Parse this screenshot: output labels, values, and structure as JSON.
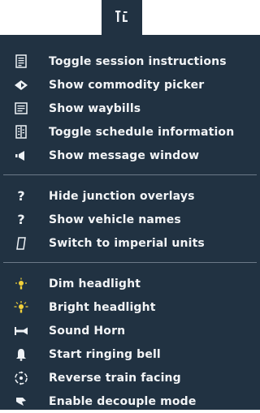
{
  "colors": {
    "panel_bg": "#213242",
    "text": "#f2f4f6",
    "headlight_yellow": "#f2d13a",
    "separator": "#6b7988"
  },
  "trigger": {
    "icon": "rail-tools-icon"
  },
  "groups": [
    [
      {
        "icon": "document-icon",
        "label": "Toggle session instructions"
      },
      {
        "icon": "commodity-picker-icon",
        "label": "Show commodity picker"
      },
      {
        "icon": "waybills-icon",
        "label": "Show waybills"
      },
      {
        "icon": "schedule-icon",
        "label": "Toggle schedule information"
      },
      {
        "icon": "message-window-icon",
        "label": "Show message window"
      }
    ],
    [
      {
        "icon": "question-icon",
        "label": "Hide junction overlays"
      },
      {
        "icon": "question-icon",
        "label": "Show vehicle names"
      },
      {
        "icon": "units-icon",
        "label": "Switch to imperial units"
      }
    ],
    [
      {
        "icon": "dim-headlight-icon",
        "label": "Dim headlight"
      },
      {
        "icon": "bright-headlight-icon",
        "label": "Bright headlight"
      },
      {
        "icon": "horn-icon",
        "label": "Sound Horn"
      },
      {
        "icon": "bell-icon",
        "label": "Start ringing bell"
      },
      {
        "icon": "reverse-icon",
        "label": "Reverse train facing"
      },
      {
        "icon": "decouple-icon",
        "label": "Enable decouple mode"
      }
    ]
  ]
}
